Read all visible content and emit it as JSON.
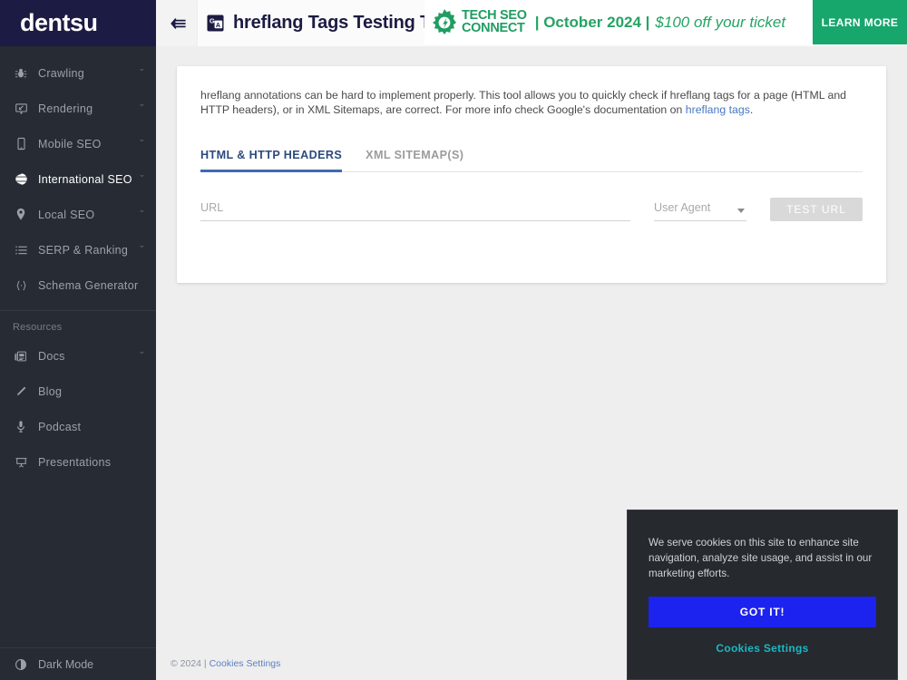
{
  "brand": {
    "name": "dentsu"
  },
  "sidebar": {
    "items": [
      {
        "label": "Crawling",
        "icon": "bug-icon",
        "caret": "ˇ",
        "active": false
      },
      {
        "label": "Rendering",
        "icon": "monitor-icon",
        "caret": "ˇ",
        "active": false
      },
      {
        "label": "Mobile SEO",
        "icon": "mobile-icon",
        "caret": "ˇ",
        "active": false
      },
      {
        "label": "International SEO",
        "icon": "globe-icon",
        "caret": "ˇ",
        "active": true
      },
      {
        "label": "Local SEO",
        "icon": "map-pin-icon",
        "caret": "ˇ",
        "active": false
      },
      {
        "label": "SERP & Ranking",
        "icon": "list-icon",
        "caret": "ˇ",
        "active": false
      },
      {
        "label": "Schema Generator",
        "icon": "code-braces-icon",
        "caret": "",
        "active": false
      }
    ],
    "resources_heading": "Resources",
    "resources": [
      {
        "label": "Docs",
        "icon": "book-icon",
        "caret": "ˇ"
      },
      {
        "label": "Blog",
        "icon": "pencil-icon",
        "caret": ""
      },
      {
        "label": "Podcast",
        "icon": "microphone-icon",
        "caret": ""
      },
      {
        "label": "Presentations",
        "icon": "presentation-icon",
        "caret": ""
      }
    ],
    "dark_mode_label": "Dark Mode",
    "dark_mode_icon": "contrast-icon"
  },
  "topbar": {
    "collapse_icon": "menu-fold-icon",
    "page_icon": "google-translate-icon",
    "page_title": "hreflang Tags Testing Tool"
  },
  "promo": {
    "logo_icon": "tech-seo-connect-gear-icon",
    "wordmark_line1": "TECH SEO",
    "wordmark_line2": "CONNECT",
    "date": "| October 2024 |",
    "offer": "$100 off your ticket",
    "cta_label": "LEARN MORE",
    "accent_color": "#25a463",
    "cta_color": "#17a66c"
  },
  "card": {
    "description_part1": "hreflang annotations can be hard to implement properly. This tool allows you to quickly check if hreflang tags for a page (HTML and HTTP headers), or in XML Sitemaps, are correct. For more info check Google's documentation on ",
    "description_link": "hreflang tags",
    "description_part2": ".",
    "tabs": [
      {
        "label": "HTML & HTTP HEADERS",
        "active": true
      },
      {
        "label": "XML SITEMAP(S)",
        "active": false
      }
    ],
    "url_placeholder": "URL",
    "url_value": "",
    "user_agent_placeholder": "User Agent",
    "user_agent_value": "",
    "test_button_label": "TEST URL"
  },
  "footer": {
    "copyright": "© 2024 |",
    "cookies_link": "Cookies Settings"
  },
  "cookie_banner": {
    "message": "We serve cookies on this site to enhance site navigation, analyze site usage, and assist in our marketing efforts.",
    "accept_label": "GOT IT!",
    "settings_label": "Cookies Settings",
    "accept_color": "#1c23ee",
    "settings_color": "#1ab8c4"
  }
}
